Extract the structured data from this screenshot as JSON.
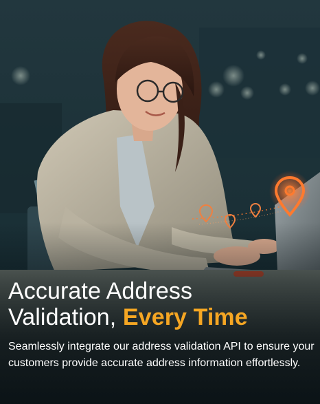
{
  "hero": {
    "headline_line1": "Accurate Address",
    "headline_line2_prefix": "Validation,",
    "headline_line2_accent": "Every Time",
    "description": "Seamlessly integrate our address validation API to ensure your customers provide accurate address information effortlessly.",
    "image_subject": "woman-working-on-laptop-with-location-pins",
    "colors": {
      "accent": "#f5a623",
      "text": "#ffffff",
      "background": "#10242b"
    }
  }
}
